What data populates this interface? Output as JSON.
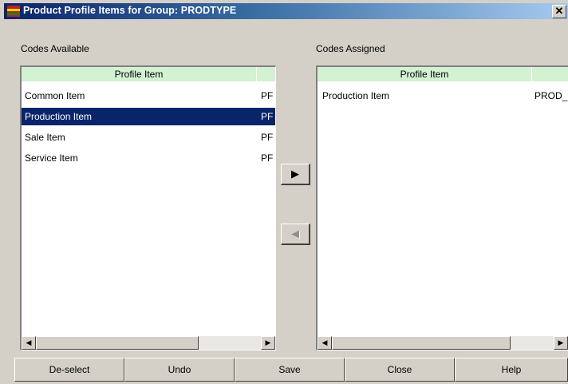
{
  "window": {
    "title": "Product Profile Items for Group: PRODTYPE",
    "close_glyph": "✕"
  },
  "available": {
    "label": "Codes Available",
    "header": "Profile Item",
    "rows": [
      {
        "item": "Common Item",
        "code": "PF",
        "selected": false
      },
      {
        "item": "Production Item",
        "code": "PF",
        "selected": true
      },
      {
        "item": "Sale Item",
        "code": "PF",
        "selected": false
      },
      {
        "item": "Service Item",
        "code": "PF",
        "selected": false
      }
    ]
  },
  "assigned": {
    "label": "Codes Assigned",
    "header": "Profile Item",
    "rows": [
      {
        "item": "Production Item",
        "code": "PROD_"
      }
    ]
  },
  "move_buttons": {
    "assign_glyph": "▶",
    "unassign_glyph": "◀"
  },
  "scroll_glyphs": {
    "left": "◀",
    "right": "▶"
  },
  "buttons": {
    "deselect": "De-select",
    "undo": "Undo",
    "save": "Save",
    "close": "Close",
    "help": "Help"
  },
  "colors": {
    "selection": "#0a246a",
    "header": "#d3f1d3",
    "titlebar_start": "#0a246a"
  }
}
